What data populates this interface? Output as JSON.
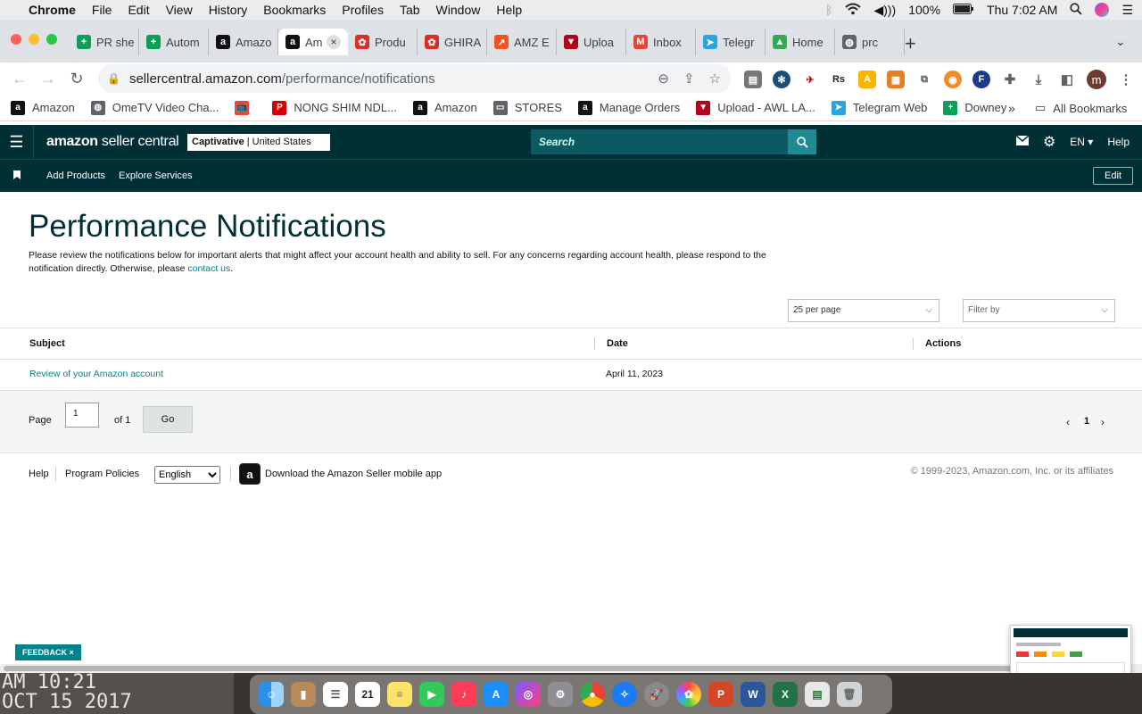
{
  "menubar": {
    "app": "Chrome",
    "items": [
      "File",
      "Edit",
      "View",
      "History",
      "Bookmarks",
      "Profiles",
      "Tab",
      "Window",
      "Help"
    ],
    "battery": "100%",
    "clock": "Thu 7:02 AM"
  },
  "tabs": [
    {
      "title": "PR she",
      "color": "#0f9d58",
      "glyph": "+"
    },
    {
      "title": "Autom",
      "color": "#0f9d58",
      "glyph": "+"
    },
    {
      "title": "Amazo",
      "color": "#111111",
      "glyph": "a"
    },
    {
      "title": "Am",
      "color": "#111111",
      "glyph": "a",
      "active": true
    },
    {
      "title": "Produ",
      "color": "#d93025",
      "glyph": "✿"
    },
    {
      "title": "GHIRA",
      "color": "#d93025",
      "glyph": "✿"
    },
    {
      "title": "AMZ E",
      "color": "#f4511e",
      "glyph": "↗"
    },
    {
      "title": "Uploa",
      "color": "#b3001b",
      "glyph": "▼"
    },
    {
      "title": "Inbox",
      "color": "#ea4335",
      "glyph": "M"
    },
    {
      "title": "Telegr",
      "color": "#2aa3de",
      "glyph": "➤"
    },
    {
      "title": "Home",
      "color": "#34a853",
      "glyph": "▲"
    },
    {
      "title": "prc",
      "color": "#5f6368",
      "glyph": "◍"
    }
  ],
  "address": {
    "host": "sellercentral.amazon.com",
    "path": "/performance/notifications"
  },
  "bookmarks": [
    {
      "label": "Amazon",
      "color": "#111111",
      "glyph": "a"
    },
    {
      "label": "OmeTV Video Cha...",
      "color": "#5f6368",
      "glyph": "◍"
    },
    {
      "label": "",
      "color": "#e8453c",
      "glyph": "📺"
    },
    {
      "label": "NONG SHIM NDL...",
      "color": "#d50000",
      "glyph": "P"
    },
    {
      "label": "Amazon",
      "color": "#111111",
      "glyph": "a"
    },
    {
      "label": "STORES",
      "color": "#5f6368",
      "glyph": "▭"
    },
    {
      "label": "Manage Orders",
      "color": "#111111",
      "glyph": "a"
    },
    {
      "label": "Upload - AWL LA...",
      "color": "#b3001b",
      "glyph": "▼"
    },
    {
      "label": "Telegram Web",
      "color": "#2aa3de",
      "glyph": "➤"
    },
    {
      "label": "Downey",
      "color": "#0f9d58",
      "glyph": "+"
    }
  ],
  "bookmarks_more": "»",
  "all_bookmarks": "All Bookmarks",
  "profile_initial": "m",
  "seller": {
    "logo_brand": "amazon",
    "logo_rest": " seller central",
    "account_name": "Captivative",
    "account_region": " | United States",
    "search_placeholder": "Search",
    "language": "EN",
    "help": "Help",
    "subnav": [
      "Add Products",
      "Explore Services"
    ],
    "edit": "Edit"
  },
  "page": {
    "title": "Performance Notifications",
    "description": "Please review the notifications below for important alerts that might affect your account health and ability to sell. For any concerns regarding account health, please respond to the notification directly. Otherwise, please ",
    "contact_link": "contact us",
    "description_end": ".",
    "per_page": "25 per page",
    "filter_placeholder": "Filter by",
    "columns": {
      "subject": "Subject",
      "date": "Date",
      "actions": "Actions"
    },
    "rows": [
      {
        "subject": "Review of your Amazon account",
        "date": "April 11, 2023"
      }
    ],
    "pager": {
      "page_label": "Page",
      "page_value": "1",
      "of_label": "of 1",
      "go": "Go",
      "current": "1"
    }
  },
  "footer": {
    "help": "Help",
    "program_policies": "Program Policies",
    "language": "English",
    "download_app": "Download the Amazon Seller mobile app",
    "copyright": "© 1999-2023, Amazon.com, Inc. or its affiliates"
  },
  "feedback": "FEEDBACK",
  "desktop_photo_text": [
    "AM 10:21",
    "OCT 15 2017"
  ]
}
